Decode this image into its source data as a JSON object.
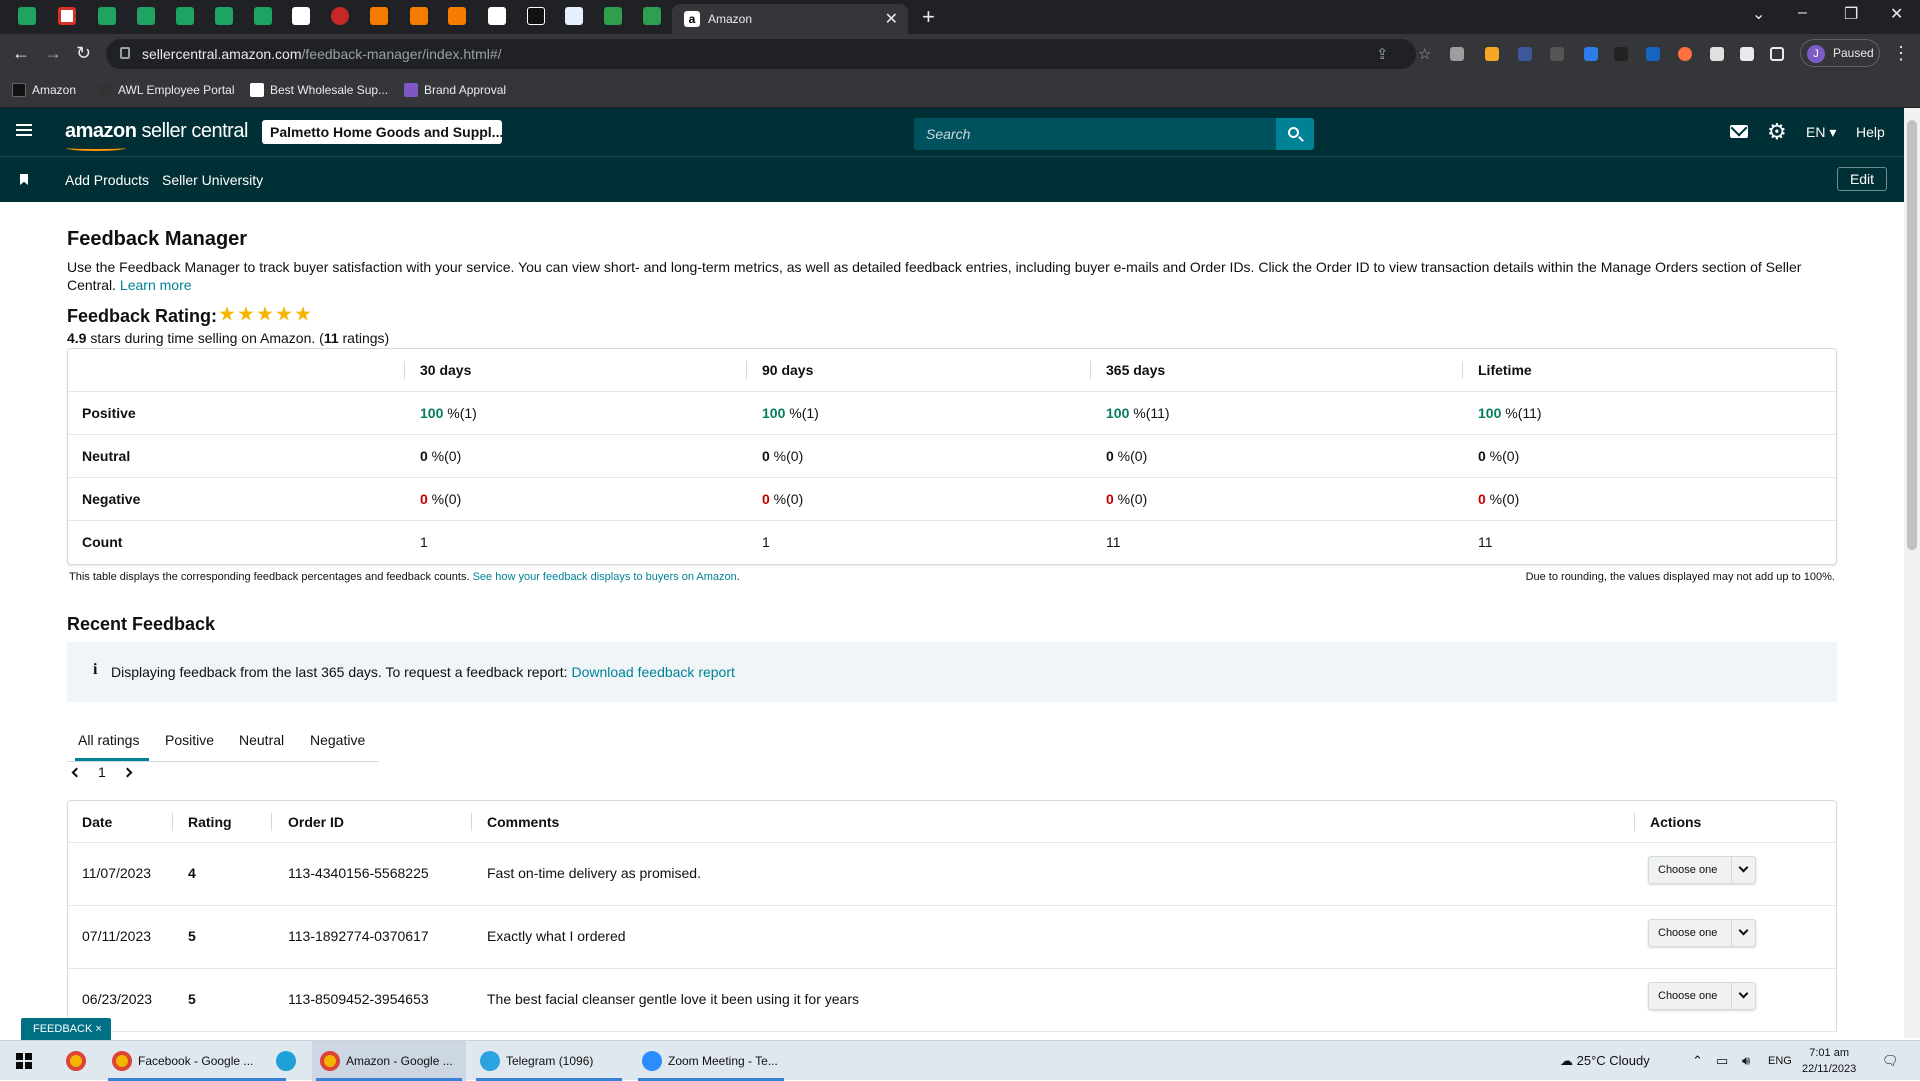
{
  "browser": {
    "active_tab_title": "Amazon",
    "url_host": "sellercentral.amazon.com",
    "url_path": "/feedback-manager/index.html#/",
    "profile_initial": "J",
    "profile_status": "Paused",
    "bookmarks": [
      "Amazon",
      "AWL Employee Portal",
      "Best Wholesale Sup...",
      "Brand Approval"
    ]
  },
  "header": {
    "logo_brand": "amazon",
    "logo_product": " seller central",
    "store_name": "Palmetto Home Goods and Suppl...",
    "search_placeholder": "Search",
    "language": "EN",
    "help": "Help"
  },
  "subnav": {
    "add_products": "Add Products",
    "seller_university": "Seller University",
    "edit": "Edit"
  },
  "page": {
    "title": "Feedback Manager",
    "intro": "Use the Feedback Manager to track buyer satisfaction with your service. You can view short- and long-term metrics, as well as detailed feedback entries, including buyer e-mails and Order IDs. Click the Order ID to view transaction details within the Manage Orders section of Seller Central.",
    "learn_more": "Learn more",
    "rating_title": "Feedback Rating:",
    "rating_value": "4.9",
    "rating_sub_mid": " stars during time selling on Amazon. (",
    "rating_count": "11",
    "rating_sub_end": " ratings)",
    "stars_shown": 5
  },
  "rating_table": {
    "columns": [
      "30 days",
      "90 days",
      "365 days",
      "Lifetime"
    ],
    "rows": [
      {
        "label": "Positive",
        "values": [
          [
            "100",
            " %(1)"
          ],
          [
            "100",
            " %(1)"
          ],
          [
            "100",
            " %(11)"
          ],
          [
            "100",
            " %(11)"
          ]
        ]
      },
      {
        "label": "Neutral",
        "values": [
          [
            "0",
            " %(0)"
          ],
          [
            "0",
            " %(0)"
          ],
          [
            "0",
            " %(0)"
          ],
          [
            "0",
            " %(0)"
          ]
        ]
      },
      {
        "label": "Negative",
        "values": [
          [
            "0",
            " %(0)"
          ],
          [
            "0",
            " %(0)"
          ],
          [
            "0",
            " %(0)"
          ],
          [
            "0",
            " %(0)"
          ]
        ]
      },
      {
        "label": "Count",
        "values": [
          [
            "1",
            ""
          ],
          [
            "1",
            ""
          ],
          [
            "11",
            ""
          ],
          [
            "11",
            ""
          ]
        ]
      }
    ],
    "note_left": "This table displays the corresponding feedback percentages and feedback counts. ",
    "note_link": "See how your feedback displays to buyers on Amazon",
    "note_link_end": ".",
    "note_right": "Due to rounding, the values displayed may not add up to 100%."
  },
  "recent": {
    "title": "Recent Feedback",
    "info_icon": "i",
    "info_text": "Displaying feedback from the last 365 days. To request a feedback report: ",
    "info_link": "Download feedback report",
    "tabs": [
      "All ratings",
      "Positive",
      "Neutral",
      "Negative"
    ],
    "page": "1",
    "columns": [
      "Date",
      "Rating",
      "Order ID",
      "Comments",
      "Actions"
    ],
    "rows": [
      {
        "date": "11/07/2023",
        "rating": "4",
        "order_id": "113-4340156-5568225",
        "comment": "Fast on-time delivery as promised.",
        "action": "Choose one"
      },
      {
        "date": "07/11/2023",
        "rating": "5",
        "order_id": "113-1892774-0370617",
        "comment": "Exactly what I ordered",
        "action": "Choose one"
      },
      {
        "date": "06/23/2023",
        "rating": "5",
        "order_id": "113-8509452-3954653",
        "comment": "The best facial cleanser gentle love it been using it for years",
        "action": "Choose one"
      }
    ]
  },
  "feedback_tag": "FEEDBACK ×",
  "taskbar": {
    "apps": [
      "Facebook - Google ...",
      "Amazon - Google ...",
      "Telegram (1096)",
      "Zoom Meeting - Te..."
    ],
    "weather": "25°C  Cloudy",
    "lang": "ENG",
    "time": "7:01 am",
    "date": "22/11/2023"
  }
}
